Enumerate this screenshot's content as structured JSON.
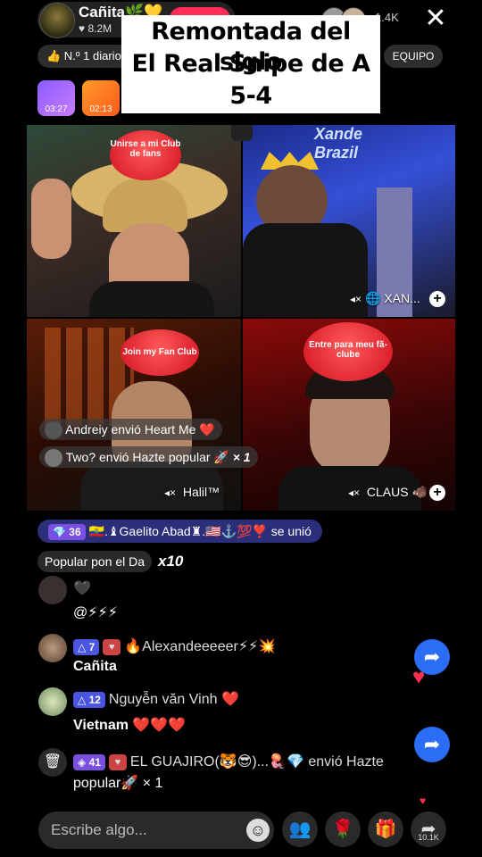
{
  "host": {
    "name": "Cañita",
    "name_emoji": "🌿💛",
    "likes": "8.2M",
    "likes_icon": "heart-icon"
  },
  "viewers": {
    "count": "1.4K"
  },
  "rank": {
    "text": "👍 N.º 1 diario"
  },
  "team": {
    "text": "EQUIPO"
  },
  "events": [
    {
      "time": "03:27"
    },
    {
      "time": "02:13"
    }
  ],
  "caption": {
    "line1": "Remontada del siglo",
    "line2": "El Real Snipe de A",
    "line3": "5-4"
  },
  "tiles": [
    {
      "club_text": "Unirse a mi Club de fans"
    },
    {
      "label": "XAN...",
      "brand": "Xande Brazil"
    },
    {
      "label": "Halil™",
      "club_text": "Join my Fan Club"
    },
    {
      "label": "CLAUS 🐗",
      "club_text": "Entre para meu fã-clube"
    }
  ],
  "tile_gifts": [
    {
      "text": "Andreiy envió Heart Me",
      "emoji": "❤️"
    },
    {
      "text": "Two? envió Hazte popular",
      "emoji": "🚀",
      "count": "× 1"
    }
  ],
  "join": {
    "level": "36",
    "text": "🇪🇨.♝Gaelito Abad♜.🇺🇸⚓️💯❣️ se unió"
  },
  "popular": {
    "label": "Popular pon el Da",
    "count": "x10"
  },
  "chat": [
    {
      "text": "🖤"
    },
    {
      "text": "@⚡⚡⚡"
    },
    {
      "level": "7",
      "name": "🔥Alexandeeeeer⚡⚡💥",
      "message": "Cañita"
    },
    {
      "level": "12",
      "name": "Nguyễn văn Vinh ❤️",
      "message": "Vietnam ❤️❤️❤️"
    },
    {
      "level": "41",
      "name": "EL GUAJIRO(🐯😎)...🪼💎 envió Hazte",
      "message": "popular🚀 × 1"
    }
  ],
  "bottom": {
    "placeholder": "Escribe algo...",
    "share_count": "10.1K"
  },
  "colors": {
    "accent": "#ff2c55",
    "level_badge": "#4a55e0",
    "share": "#2b6ef5"
  }
}
